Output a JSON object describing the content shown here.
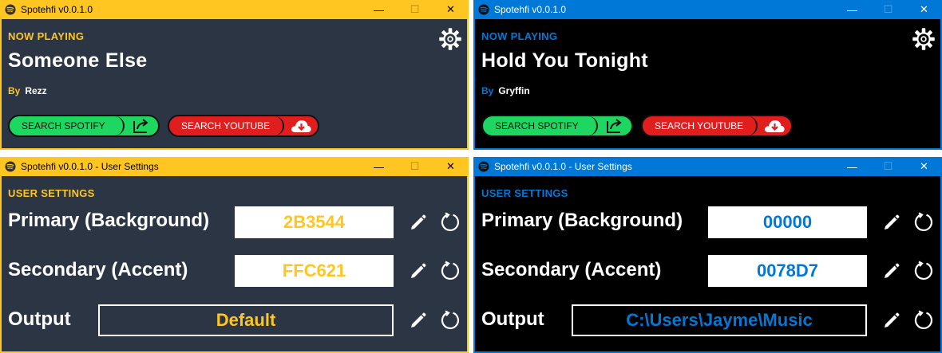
{
  "colors": {
    "yellow_theme_accent": "#FFC621",
    "yellow_theme_background": "#2B3544",
    "blue_theme_accent": "#0078D7",
    "blue_theme_background": "#000000",
    "spotify_green": "#1ED760",
    "youtube_red": "#E01E1E"
  },
  "windows": {
    "main_yellow": {
      "title": "Spotehfi v0.0.1.0",
      "section_label": "NOW PLAYING",
      "song_title": "Someone Else",
      "by_label": "By",
      "artist": "Rezz",
      "search_spotify_label": "SEARCH SPOTIFY",
      "search_youtube_label": "SEARCH YOUTUBE"
    },
    "main_blue": {
      "title": "Spotehfi v0.0.1.0",
      "section_label": "NOW PLAYING",
      "song_title": "Hold You Tonight",
      "by_label": "By",
      "artist": "Gryffin",
      "search_spotify_label": "SEARCH SPOTIFY",
      "search_youtube_label": "SEARCH YOUTUBE"
    },
    "settings_yellow": {
      "title": "Spotehfi v0.0.1.0 - User Settings",
      "section_label": "USER SETTINGS",
      "primary_label": "Primary (Background)",
      "primary_value": "2B3544",
      "secondary_label": "Secondary (Accent)",
      "secondary_value": "FFC621",
      "output_label": "Output",
      "output_value": "Default"
    },
    "settings_blue": {
      "title": "Spotehfi v0.0.1.0 - User Settings",
      "section_label": "USER SETTINGS",
      "primary_label": "Primary (Background)",
      "primary_value": "00000",
      "secondary_label": "Secondary (Accent)",
      "secondary_value": "0078D7",
      "output_label": "Output",
      "output_value": "C:\\Users\\Jayme\\Music"
    }
  },
  "icons": {
    "app": "spotify-logo-icon",
    "settings": "gear-icon",
    "share": "share-arrow-icon",
    "download": "cloud-download-icon",
    "edit": "pencil-icon",
    "reset": "reset-icon",
    "minimize": "minimize-icon",
    "maximize": "maximize-icon",
    "close": "close-icon"
  },
  "window_controls": {
    "minimize": "—",
    "maximize": "☐",
    "close": "✕"
  }
}
